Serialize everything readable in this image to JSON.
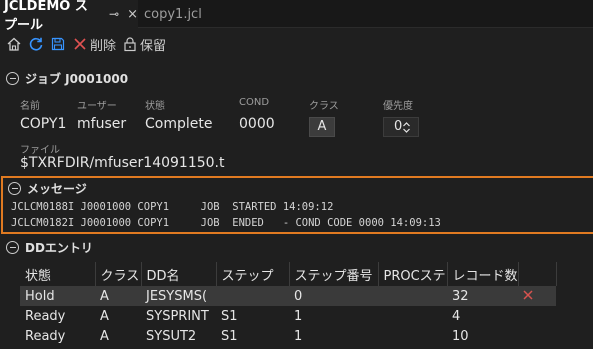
{
  "tabs": [
    {
      "label": "JCLDEMO スプール",
      "pin": "⊸",
      "close": "×"
    },
    {
      "label": "copy1.jcl"
    }
  ],
  "toolbar": {
    "delete_label": "削除",
    "keep_label": "保留"
  },
  "job": {
    "header": "ジョブ J0001000",
    "labels": {
      "name": "名前",
      "user": "ユーザー",
      "status": "状態",
      "cond": "COND",
      "class": "クラス",
      "priority": "優先度",
      "file": "ファイル"
    },
    "name": "COPY1",
    "user": "mfuser",
    "status": "Complete",
    "cond": "0000",
    "class": "A",
    "priority": "0",
    "file": "$TXRFDIR/mfuser14091150.t"
  },
  "messages": {
    "header": "メッセージ",
    "lines": [
      "JCLCM0188I J0001000 COPY1     JOB  STARTED 14:09:12",
      "JCLCM0182I J0001000 COPY1     JOB  ENDED   - COND CODE 0000 14:09:13"
    ]
  },
  "dd": {
    "header": "DDエントリ",
    "columns": [
      "状態",
      "クラス",
      "DD名",
      "ステップ",
      "ステップ番号",
      "PROCステ",
      "レコード数"
    ],
    "rows": [
      [
        "Hold",
        "A",
        "JESYSMS(",
        "",
        "0",
        "",
        "32"
      ],
      [
        "Ready",
        "A",
        "SYSPRINT",
        "S1",
        "1",
        "",
        "4"
      ],
      [
        "Ready",
        "A",
        "SYSUT2",
        "S1",
        "1",
        "",
        "10"
      ]
    ]
  },
  "colors": {
    "accent_border": "#e07a21",
    "selected_row": "#3a3a3a",
    "delete_red": "#d9534f"
  }
}
